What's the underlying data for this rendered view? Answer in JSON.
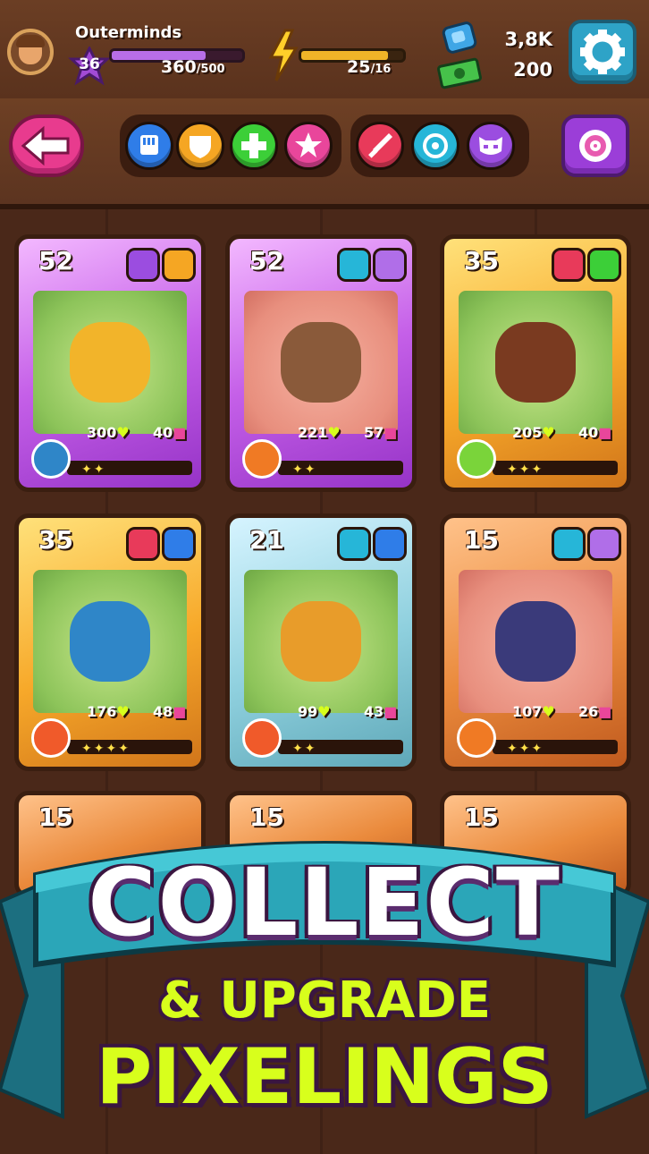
{
  "header": {
    "username": "Outerminds",
    "player_level": "36",
    "xp": {
      "current": "360",
      "max": "/500",
      "fraction": 0.72
    },
    "energy": {
      "current": "25",
      "max": "/16",
      "fraction": 0.85
    },
    "gems": "3,8K",
    "cash": "200",
    "icons": {
      "avatar": "player-avatar",
      "level": "level-star-icon",
      "energy": "lightning-bolt-icon",
      "gems": "gem-icon",
      "cash": "cash-icon",
      "settings": "gear-icon"
    }
  },
  "filters": {
    "back": "back-arrow-icon",
    "group1": [
      "fist-icon",
      "shield-icon",
      "plus-icon",
      "star-icon"
    ],
    "group2": [
      "sword-icon",
      "target-icon",
      "mask-icon"
    ],
    "special": "swirl-icon",
    "colors": [
      "#2f7de8",
      "#f5a623",
      "#3ccf38",
      "#e9469b",
      "#e83a5a",
      "#26b6d8",
      "#9b4de0"
    ]
  },
  "cards": [
    {
      "level": "52",
      "hp": "300",
      "atk": "40",
      "stars": "✦✦",
      "frame": "purple",
      "art": "green",
      "creature_color": "#f2b42a"
    },
    {
      "level": "52",
      "hp": "221",
      "atk": "57",
      "stars": "✦✦",
      "frame": "purple",
      "art": "pink",
      "creature_color": "#8a5a3a"
    },
    {
      "level": "35",
      "hp": "205",
      "atk": "40",
      "stars": "✦✦✦",
      "frame": "gold",
      "art": "green",
      "creature_color": "#7a3a20"
    },
    {
      "level": "35",
      "hp": "176",
      "atk": "48",
      "stars": "✦✦✦✦",
      "frame": "gold",
      "art": "green",
      "creature_color": "#2f86c8"
    },
    {
      "level": "21",
      "hp": "99",
      "atk": "43",
      "stars": "✦✦",
      "frame": "silver",
      "art": "green",
      "creature_color": "#e89c2a"
    },
    {
      "level": "15",
      "hp": "107",
      "atk": "26",
      "stars": "✦✦✦",
      "frame": "bronze",
      "art": "pink",
      "creature_color": "#3a3a7a"
    }
  ],
  "partial_cards": [
    "15",
    "15",
    "15"
  ],
  "promo": {
    "line1": "COLLECT",
    "line2": "& UPGRADE",
    "line3": "PIXELINGS"
  }
}
